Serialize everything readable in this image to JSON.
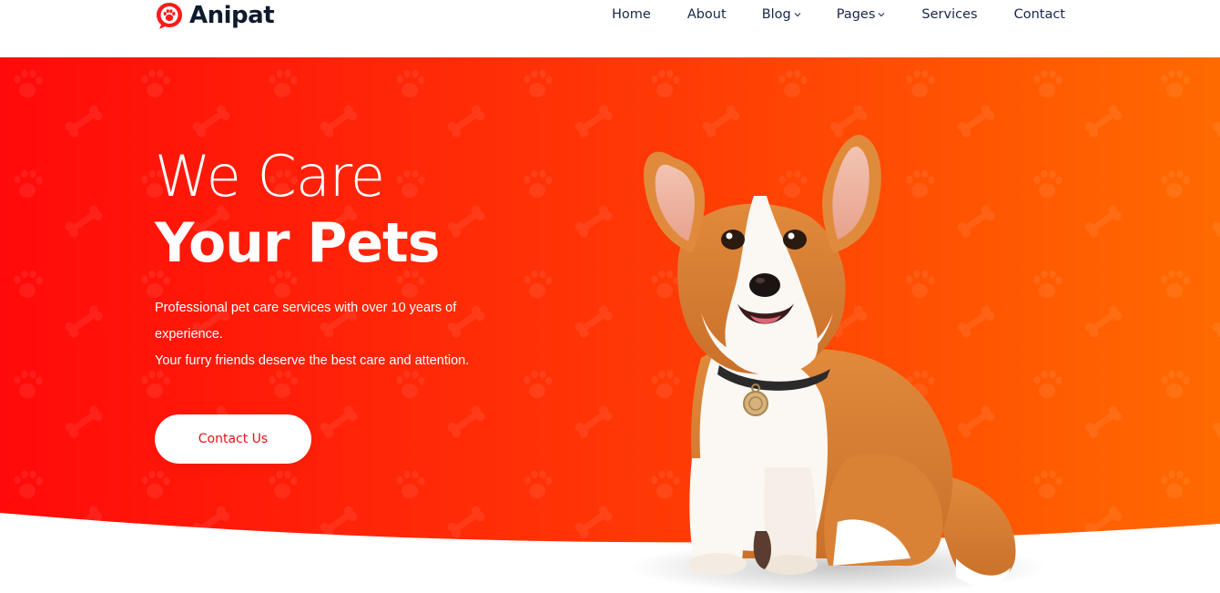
{
  "brand": {
    "name": "Anipat",
    "logo_icon": "paw-chat-icon"
  },
  "nav": {
    "items": [
      {
        "label": "Home",
        "has_dropdown": false
      },
      {
        "label": "About",
        "has_dropdown": false
      },
      {
        "label": "Blog",
        "has_dropdown": true
      },
      {
        "label": "Pages",
        "has_dropdown": true
      },
      {
        "label": "Services",
        "has_dropdown": false
      },
      {
        "label": "Contact",
        "has_dropdown": false
      }
    ]
  },
  "hero": {
    "title_line1": "We Care",
    "title_line2": "Your Pets",
    "description_line1": "Professional pet care services with over 10 years of",
    "description_line2": "experience.",
    "description_line3": "Your furry friends deserve the best care and attention.",
    "cta_label": "Contact Us",
    "image": "corgi-puppy-illustration"
  },
  "colors": {
    "accent": "#ff1010",
    "gradient_start": "#ff0a0a",
    "gradient_end": "#ff6a00",
    "nav_text": "#18264a",
    "button_text": "#e4111a"
  }
}
